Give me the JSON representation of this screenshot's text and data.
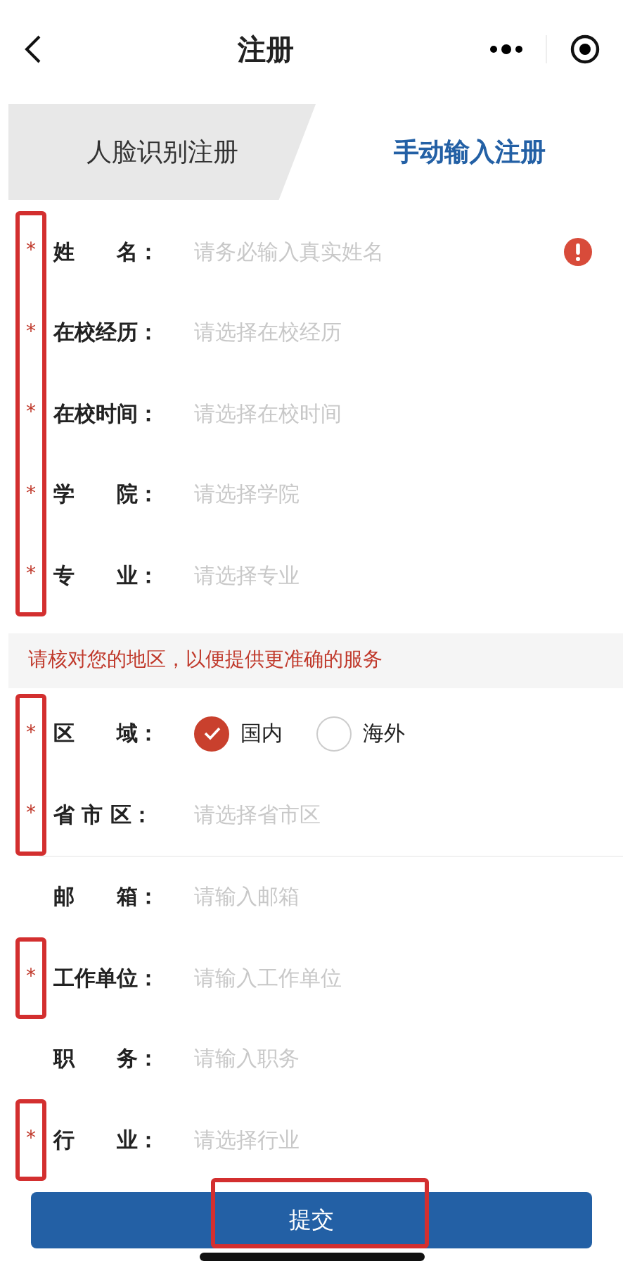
{
  "header": {
    "title": "注册"
  },
  "tabs": [
    {
      "label": "人脸识别注册",
      "selected": false
    },
    {
      "label": "手动输入注册",
      "selected": true
    }
  ],
  "groups": [
    {
      "asterisk_frame": true,
      "fields": [
        {
          "kind": "text",
          "mark": "*",
          "label": "姓　　名：",
          "placeholder": "请务必输入真实姓名",
          "error": true
        },
        {
          "kind": "picker",
          "mark": "*",
          "label": "在校经历：",
          "placeholder": "请选择在校经历"
        },
        {
          "kind": "picker",
          "mark": "*",
          "label": "在校时间：",
          "placeholder": "请选择在校时间"
        },
        {
          "kind": "picker",
          "mark": "*",
          "label": "学　　院：",
          "placeholder": "请选择学院"
        },
        {
          "kind": "picker",
          "mark": "*",
          "label": "专　　业：",
          "placeholder": "请选择专业"
        }
      ]
    },
    {
      "notice": "请核对您的地区，以便提供更准确的服务"
    },
    {
      "asterisk_frame": true,
      "fields": [
        {
          "kind": "radio",
          "mark": "*",
          "label": "区　　域：",
          "options": [
            {
              "label": "国内",
              "selected": true
            },
            {
              "label": "海外",
              "selected": false
            }
          ]
        },
        {
          "kind": "picker",
          "mark": "*",
          "label": "省 市 区：",
          "placeholder": "请选择省市区"
        }
      ]
    },
    {
      "asterisk_frame": false,
      "fields": [
        {
          "kind": "text",
          "label": "邮　　箱：",
          "placeholder": "请输入邮箱"
        }
      ]
    },
    {
      "asterisk_frame": true,
      "fields": [
        {
          "kind": "text",
          "mark": "*",
          "label": "工作单位：",
          "placeholder": "请输入工作单位"
        }
      ]
    },
    {
      "asterisk_frame": false,
      "fields": [
        {
          "kind": "text",
          "label": "职　　务：",
          "placeholder": "请输入职务"
        }
      ]
    },
    {
      "asterisk_frame": true,
      "fields": [
        {
          "kind": "picker",
          "mark": "*",
          "label": "行　　业：",
          "placeholder": "请选择行业"
        }
      ]
    }
  ],
  "submit": {
    "label": "提交",
    "framed": true
  }
}
